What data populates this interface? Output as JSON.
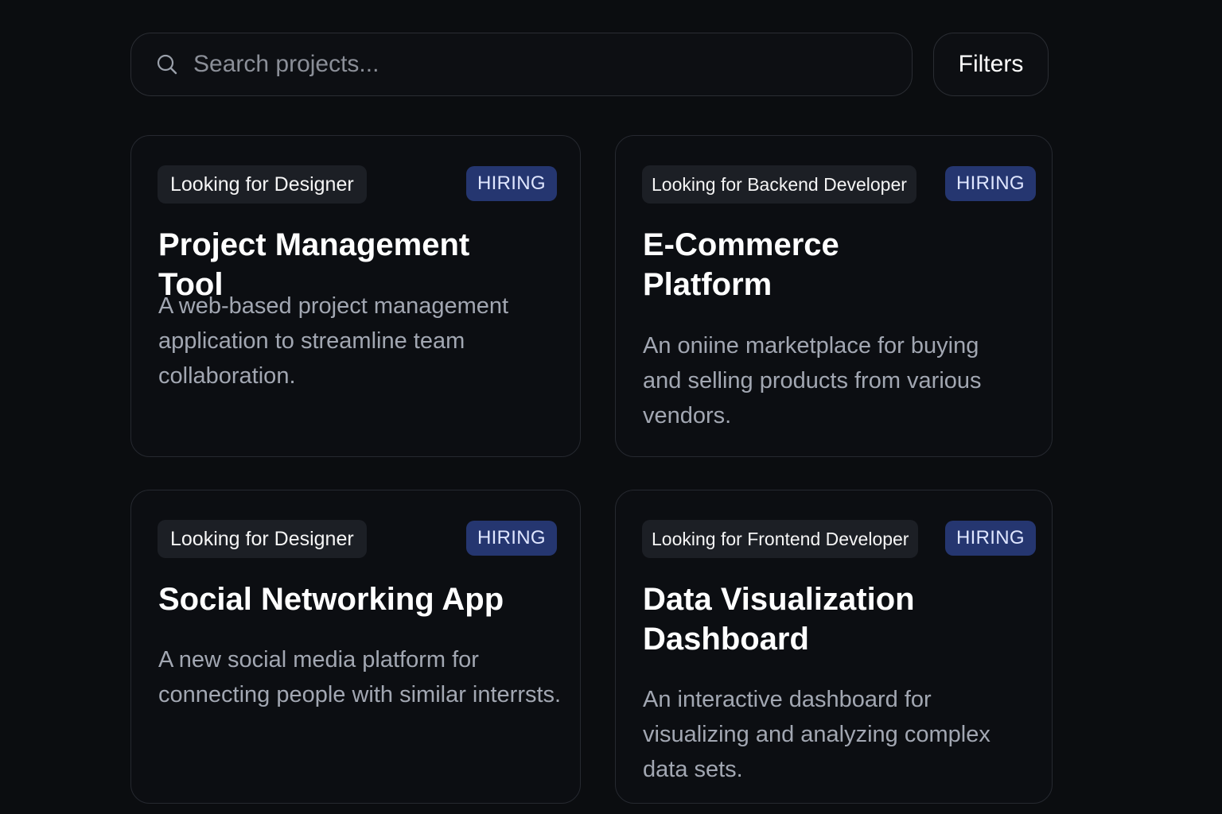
{
  "search": {
    "placeholder": "Search projects...",
    "value": ""
  },
  "toolbar": {
    "filters_label": "Filters"
  },
  "projects": [
    {
      "role": "Looking for Designer",
      "badge": "HIRING",
      "title": "Project Management Tool",
      "description": "A web-based project management application to streamline team collaboration."
    },
    {
      "role": "Looking for Backend Developer",
      "badge": "HIRING",
      "title": "E-Commerce Platform",
      "description": "An oniine marketplace for buying and selling products from various vendors."
    },
    {
      "role": "Looking for Designer",
      "badge": "HIRING",
      "title": "Social Networking App",
      "description": "A new social media platform for connecting people with similar interrsts."
    },
    {
      "role": "Looking for Frontend Developer",
      "badge": "HIRING",
      "title": "Data Visualization Dashboard",
      "description": "An interactive dashboard for visualizing and analyzing complex data sets."
    }
  ],
  "colors": {
    "background": "#0b0d10",
    "badge": "#253670",
    "tag": "#1c1f25"
  },
  "icons": {
    "search": "search-icon"
  }
}
